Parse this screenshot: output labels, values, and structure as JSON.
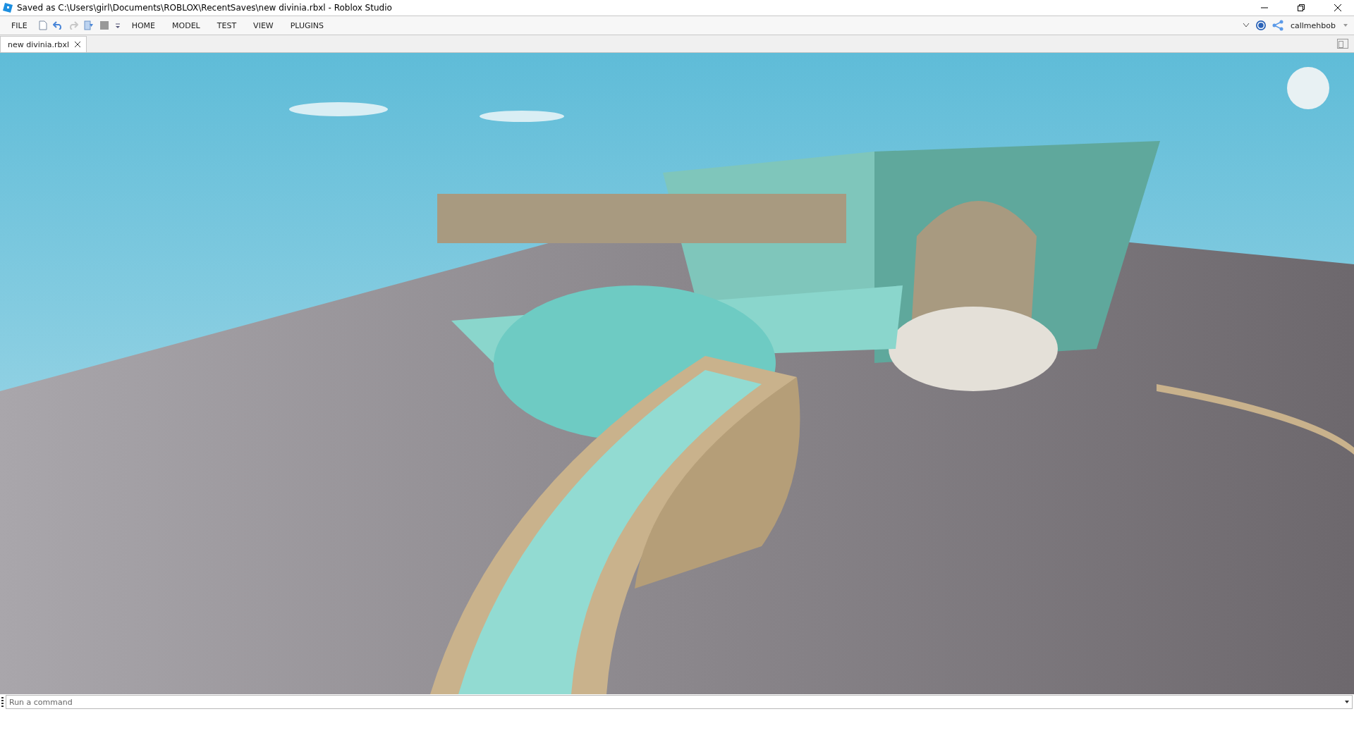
{
  "window": {
    "title": "Saved as C:\\Users\\girl\\Documents\\ROBLOX\\RecentSaves\\new divinia.rbxl - Roblox Studio"
  },
  "menu": {
    "file": "FILE",
    "tabs": [
      {
        "label": "HOME"
      },
      {
        "label": "MODEL"
      },
      {
        "label": "TEST"
      },
      {
        "label": "VIEW"
      },
      {
        "label": "PLUGINS"
      }
    ]
  },
  "account": {
    "username": "callmehbob"
  },
  "document_tabs": [
    {
      "label": "new divinia.rbxl",
      "selected": true
    }
  ],
  "command_bar": {
    "placeholder": "Run a command"
  }
}
